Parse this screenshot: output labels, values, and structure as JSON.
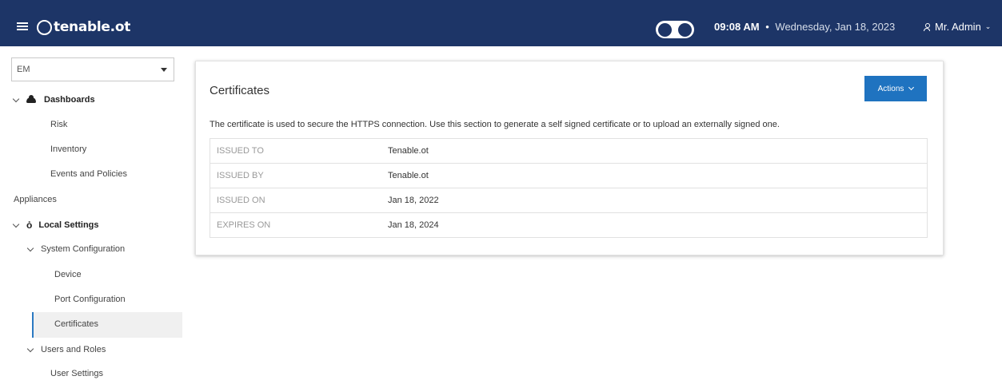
{
  "header": {
    "logo_text": "tenable.ot",
    "time": "09:08 AM",
    "separator": "•",
    "date": "Wednesday, Jan 18, 2023",
    "user_name": "Mr. Admin"
  },
  "sidebar": {
    "site_select_value": "EM",
    "groups": [
      {
        "label": "Dashboards",
        "icon": "cloud-icon",
        "items": [
          "Risk",
          "Inventory",
          "Events and Policies"
        ]
      },
      {
        "label": "Appliances"
      },
      {
        "label": "Local Settings",
        "icon": "gear-icon"
      }
    ],
    "system_configuration": {
      "label": "System Configuration",
      "items": [
        "Device",
        "Port Configuration",
        "Certificates"
      ]
    },
    "users_and_roles": {
      "label": "Users and Roles",
      "items": [
        "User Settings"
      ]
    },
    "active_item": "Certificates"
  },
  "card": {
    "title": "Certificates",
    "actions_label": "Actions",
    "description": "The certificate is used to secure the HTTPS connection. Use this section to generate a self signed certificate or to upload an externally signed one.",
    "rows": [
      {
        "key": "ISSUED TO",
        "value": "Tenable.ot"
      },
      {
        "key": "ISSUED BY",
        "value": "Tenable.ot"
      },
      {
        "key": "ISSUED ON",
        "value": "Jan 18, 2022"
      },
      {
        "key": "EXPIRES ON",
        "value": "Jan 18, 2024"
      }
    ]
  },
  "colors": {
    "topbar": "#1d3567",
    "accent": "#1f73c0"
  }
}
